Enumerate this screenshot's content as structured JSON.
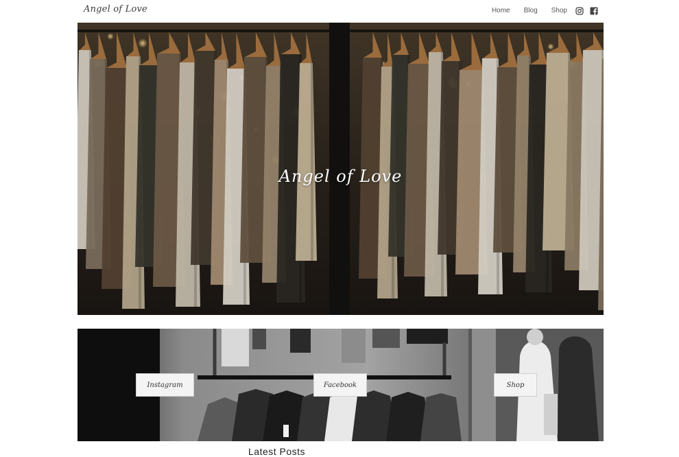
{
  "header": {
    "logo": "Angel of Love",
    "nav": [
      "Home",
      "Blog",
      "Shop"
    ],
    "social_icons": [
      "instagram-icon",
      "facebook-icon"
    ]
  },
  "hero": {
    "title": "Angel of Love"
  },
  "banner": {
    "buttons": [
      "Instagram",
      "Facebook",
      "Shop"
    ]
  },
  "latest": {
    "heading": "Latest Posts"
  },
  "colors": {
    "text": "#3a3a3a",
    "nav_text": "#555555",
    "button_bg": "#f4f4f4"
  }
}
